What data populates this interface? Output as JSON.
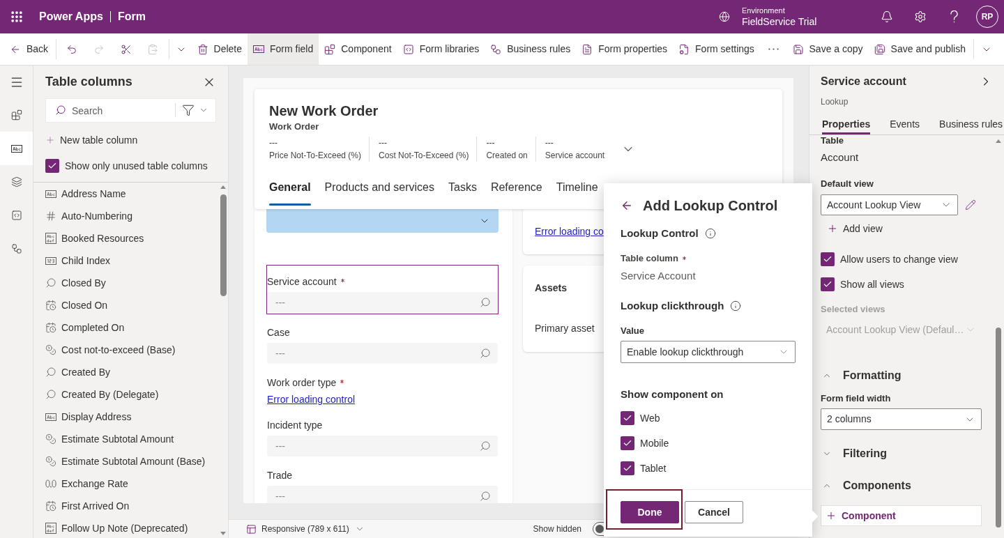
{
  "app_bar": {
    "app_name": "Power Apps",
    "page_name": "Form",
    "environment_label": "Environment",
    "environment_name": "FieldService Trial",
    "avatar_initials": "RP"
  },
  "command_bar": {
    "groups": [
      [
        {
          "kind": "back",
          "label": "Back",
          "selected": false,
          "disabled": false
        }
      ],
      [
        {
          "kind": "undo",
          "selected": false,
          "disabled": false
        },
        {
          "kind": "redo",
          "selected": false,
          "disabled": true
        },
        {
          "kind": "cut",
          "selected": false,
          "disabled": false
        },
        {
          "kind": "paste",
          "selected": false,
          "disabled": true
        }
      ],
      [
        {
          "kind": "expand",
          "selected": false,
          "disabled": false
        },
        {
          "kind": "delete",
          "label": "Delete",
          "selected": false,
          "disabled": false
        },
        {
          "kind": "form_field",
          "label": "Form field",
          "selected": true,
          "disabled": false
        },
        {
          "kind": "component",
          "label": "Component",
          "selected": false,
          "disabled": false
        },
        {
          "kind": "form_libraries",
          "label": "Form libraries",
          "selected": false,
          "disabled": false
        },
        {
          "kind": "business_rules",
          "label": "Business rules",
          "selected": false,
          "disabled": false
        },
        {
          "kind": "form_properties",
          "label": "Form properties",
          "selected": false,
          "disabled": false
        },
        {
          "kind": "form_settings",
          "label": "Form settings",
          "selected": false,
          "disabled": false
        },
        {
          "kind": "more",
          "selected": false,
          "disabled": false
        }
      ]
    ],
    "end_groups": [
      [
        {
          "kind": "save_copy",
          "label": "Save a copy",
          "selected": false,
          "disabled": false
        },
        {
          "kind": "save_publish",
          "label": "Save and publish",
          "selected": false,
          "disabled": false
        }
      ],
      [
        {
          "kind": "expand",
          "selected": false,
          "disabled": false
        }
      ]
    ]
  },
  "rail": {
    "items": [
      {
        "kind": "components",
        "selected": false
      },
      {
        "kind": "table_columns",
        "selected": true
      },
      {
        "kind": "tree_view",
        "selected": false
      },
      {
        "kind": "form_libraries",
        "selected": false
      },
      {
        "kind": "business_rules",
        "selected": false
      }
    ]
  },
  "columns_panel": {
    "title": "Table columns",
    "search": {
      "placeholder": "Search"
    },
    "new_column_label": "New table column",
    "unused_filter": {
      "label": "Show only unused table columns",
      "checked": true
    },
    "columns": [
      {
        "kind": "text",
        "name": "Address Name"
      },
      {
        "kind": "autonumber",
        "name": "Auto-Numbering"
      },
      {
        "kind": "multiline",
        "name": "Booked Resources"
      },
      {
        "kind": "wholenumber",
        "name": "Child Index"
      },
      {
        "kind": "lookup",
        "name": "Closed By"
      },
      {
        "kind": "datetime",
        "name": "Closed On"
      },
      {
        "kind": "datetime",
        "name": "Completed On"
      },
      {
        "kind": "currency",
        "name": "Cost not-to-exceed (Base)"
      },
      {
        "kind": "lookup",
        "name": "Created By"
      },
      {
        "kind": "lookup",
        "name": "Created By (Delegate)"
      },
      {
        "kind": "text",
        "name": "Display Address"
      },
      {
        "kind": "currency",
        "name": "Estimate Subtotal Amount"
      },
      {
        "kind": "currency",
        "name": "Estimate Subtotal Amount (Base)"
      },
      {
        "kind": "decimal",
        "name": "Exchange Rate"
      },
      {
        "kind": "datetime",
        "name": "First Arrived On"
      },
      {
        "kind": "multiline",
        "name": "Follow Up Note (Deprecated)"
      }
    ]
  },
  "form": {
    "title": "New Work Order",
    "entity": "Work Order",
    "header_fields": [
      {
        "value": "---",
        "label": "Price Not-To-Exceed (%)"
      },
      {
        "value": "---",
        "label": "Cost Not-To-Exceed (%)"
      },
      {
        "value": "---",
        "label": "Created on"
      },
      {
        "value": "---",
        "label": "Service account"
      }
    ],
    "tabs": [
      {
        "label": "General",
        "selected": true
      },
      {
        "label": "Products and services",
        "selected": false
      },
      {
        "label": "Tasks",
        "selected": false
      },
      {
        "label": "Reference",
        "selected": false
      },
      {
        "label": "Timeline",
        "selected": false
      }
    ],
    "main_section": {
      "fields": [
        {
          "kind": "lookup",
          "label": "Service account",
          "required": true,
          "selected": true,
          "placeholder": "---"
        },
        {
          "kind": "lookup",
          "label": "Case",
          "required": false,
          "selected": false,
          "placeholder": "---"
        },
        {
          "kind": "error",
          "label": "Work order type",
          "required": true,
          "selected": false,
          "link": "Error loading control"
        },
        {
          "kind": "lookup",
          "label": "Incident type",
          "required": false,
          "selected": false,
          "placeholder": "---"
        },
        {
          "kind": "lookup",
          "label": "Trade",
          "required": false,
          "selected": false,
          "placeholder": "---"
        }
      ]
    },
    "side_cards": [
      {
        "kind": "error",
        "link": "Error loading co"
      },
      {
        "kind": "section",
        "title": "Assets",
        "field_label": "Primary asset"
      }
    ]
  },
  "canvas_footer": {
    "view": "Responsive (789 x 611)",
    "show_hidden": {
      "label": "Show hidden",
      "on": false
    }
  },
  "lookup_dialog": {
    "title": "Add Lookup Control",
    "control_heading": "Lookup Control",
    "column_label": "Table column",
    "column_required": true,
    "column_value": "Service Account",
    "clickthrough_heading": "Lookup clickthrough",
    "value_label": "Value",
    "value_selected": "Enable lookup clickthrough",
    "show_on_heading": "Show component on",
    "platforms": [
      {
        "label": "Web",
        "checked": true
      },
      {
        "label": "Mobile",
        "checked": true
      },
      {
        "label": "Tablet",
        "checked": true
      }
    ],
    "buttons": [
      {
        "kind": "primary",
        "label": "Done",
        "highlighted": true
      },
      {
        "kind": "secondary",
        "label": "Cancel",
        "highlighted": false
      }
    ]
  },
  "properties_panel": {
    "title": "Service account",
    "subtitle": "Lookup",
    "tabs": [
      {
        "label": "Properties",
        "selected": true
      },
      {
        "label": "Events",
        "selected": false
      },
      {
        "label": "Business rules",
        "selected": false
      }
    ],
    "table_label": "Table",
    "table_value": "Account",
    "default_view_label": "Default view",
    "default_view_value": "Account Lookup View",
    "add_view_label": "Add view",
    "options": [
      {
        "label": "Allow users to change view",
        "checked": true
      },
      {
        "label": "Show all views",
        "checked": true
      }
    ],
    "selected_views": {
      "label": "Selected views",
      "value": "Account Lookup View (Defaul…",
      "disabled": true
    },
    "sections": [
      {
        "title": "Formatting",
        "expanded": true,
        "field_label": "Form field width",
        "field_value": "2 columns"
      },
      {
        "title": "Filtering",
        "expanded": false
      },
      {
        "title": "Components",
        "expanded": true,
        "button_label": "Component"
      }
    ]
  }
}
